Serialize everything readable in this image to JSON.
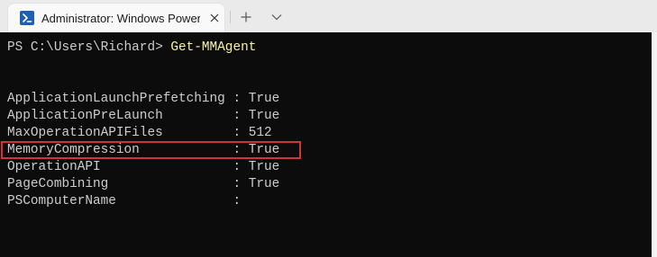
{
  "window": {
    "tab_title": "Administrator: Windows PowerShell",
    "tab_icon": "powershell-icon",
    "close_icon": "close-icon",
    "new_tab_icon": "plus-icon",
    "dropdown_icon": "chevron-down-icon"
  },
  "terminal": {
    "prompt": "PS C:\\Users\\Richard> ",
    "command": "Get-MMAgent",
    "output": [
      {
        "property": "ApplicationLaunchPrefetching",
        "value": "True",
        "highlighted": false
      },
      {
        "property": "ApplicationPreLaunch",
        "value": "True",
        "highlighted": false
      },
      {
        "property": "MaxOperationAPIFiles",
        "value": "512",
        "highlighted": false
      },
      {
        "property": "MemoryCompression",
        "value": "True",
        "highlighted": true
      },
      {
        "property": "OperationAPI",
        "value": "True",
        "highlighted": false
      },
      {
        "property": "PageCombining",
        "value": "True",
        "highlighted": false
      },
      {
        "property": "PSComputerName",
        "value": "",
        "highlighted": false
      }
    ],
    "separator": " : "
  },
  "colors": {
    "terminal_bg": "#0c0c0c",
    "terminal_fg": "#cccccc",
    "command_fg": "#f9f1a5",
    "highlight_border": "#d13438",
    "titlebar_bg": "#eaeaea"
  }
}
